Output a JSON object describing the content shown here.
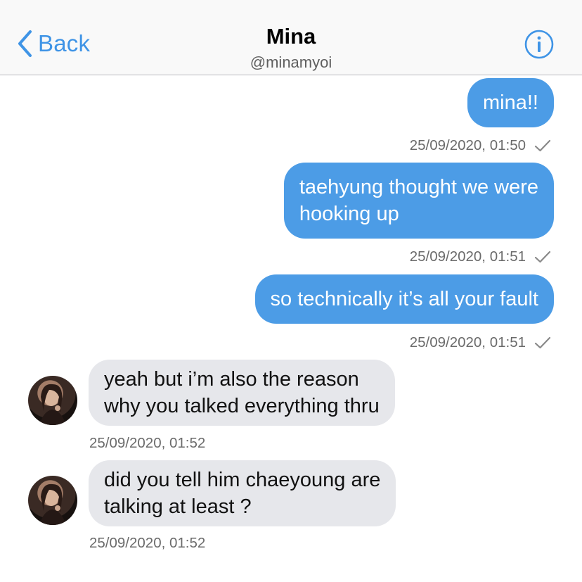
{
  "header": {
    "back_label": "Back",
    "title": "Mina",
    "handle": "@minamyoi"
  },
  "colors": {
    "accent": "#3f94e6",
    "outgoing_bubble": "#4c9ce6",
    "incoming_bubble": "#e6e7eb"
  },
  "icons": {
    "back": "chevron-left-icon",
    "info": "info-circle-icon",
    "sent_check": "checkmark-icon"
  },
  "messages": [
    {
      "direction": "outgoing",
      "lines": [
        "mina!!"
      ],
      "timestamp": "25/09/2020, 01:50"
    },
    {
      "direction": "outgoing",
      "lines": [
        "taehyung thought we were",
        "hooking up"
      ],
      "timestamp": "25/09/2020, 01:51"
    },
    {
      "direction": "outgoing",
      "lines": [
        "so technically it’s all your fault"
      ],
      "timestamp": "25/09/2020, 01:51"
    },
    {
      "direction": "incoming",
      "lines": [
        "yeah but i’m also the reason",
        "why you talked everything thru"
      ],
      "timestamp": "25/09/2020, 01:52"
    },
    {
      "direction": "incoming",
      "lines": [
        "did you tell him chaeyoung are",
        "talking at least ?"
      ],
      "timestamp": "25/09/2020, 01:52"
    }
  ]
}
